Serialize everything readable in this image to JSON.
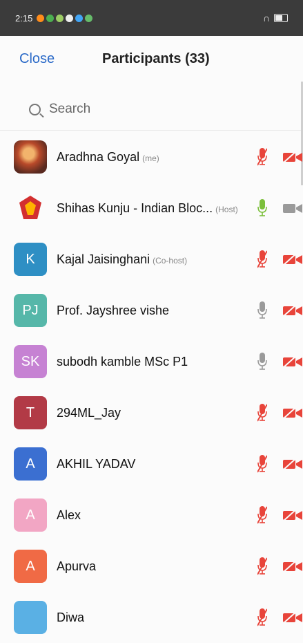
{
  "status_bar": {
    "time": "2:15"
  },
  "header": {
    "close_label": "Close",
    "title": "Participants (33)"
  },
  "search": {
    "placeholder": "Search"
  },
  "participants": [
    {
      "name": "Aradhna Goyal",
      "tag": "(me)",
      "avatar": "",
      "avatar_color": "#b94a2a",
      "mic": "muted",
      "video": "off"
    },
    {
      "name": "Shihas Kunju - Indian Bloc...",
      "tag": "(Host)",
      "avatar": "",
      "avatar_color": "#d32f2f",
      "mic": "active",
      "video": "on"
    },
    {
      "name": "Kajal Jaisinghani",
      "tag": "(Co-host)",
      "avatar": "K",
      "avatar_color": "#2e8fc4",
      "mic": "muted",
      "video": "off"
    },
    {
      "name": "Prof. Jayshree vishe",
      "tag": "",
      "avatar": "PJ",
      "avatar_color": "#56b7a9",
      "mic": "unmuted",
      "video": "off"
    },
    {
      "name": "subodh kamble MSc P1",
      "tag": "",
      "avatar": "SK",
      "avatar_color": "#c682d3",
      "mic": "unmuted",
      "video": "off"
    },
    {
      "name": "294ML_Jay",
      "tag": "",
      "avatar": "T",
      "avatar_color": "#b23a46",
      "mic": "muted",
      "video": "off"
    },
    {
      "name": "AKHIL YADAV",
      "tag": "",
      "avatar": "A",
      "avatar_color": "#3b6fd1",
      "mic": "muted",
      "video": "off"
    },
    {
      "name": "Alex",
      "tag": "",
      "avatar": "A",
      "avatar_color": "#f2a6c4",
      "mic": "muted",
      "video": "off"
    },
    {
      "name": "Apurva",
      "tag": "",
      "avatar": "A",
      "avatar_color": "#f06a45",
      "mic": "muted",
      "video": "off"
    },
    {
      "name": "Diwa",
      "tag": "",
      "avatar": "",
      "avatar_color": "#5ab0e4",
      "mic": "muted",
      "video": "off"
    }
  ],
  "colors": {
    "muted": "#e8443a",
    "active_mic": "#7bbf3a",
    "neutral_mic": "#9a9a9a",
    "link": "#2b6ac8"
  }
}
